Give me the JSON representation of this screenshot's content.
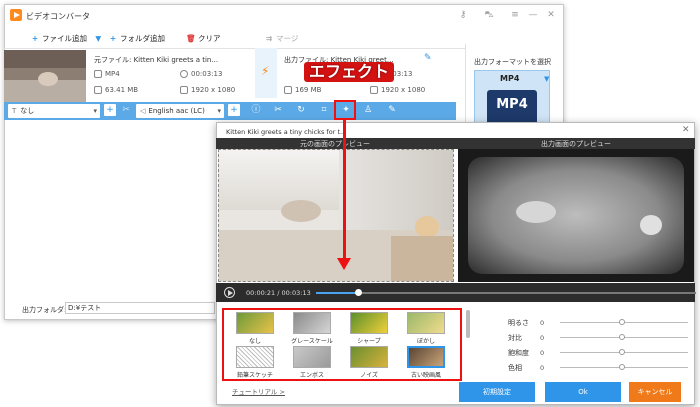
{
  "main_window": {
    "title": "ビデオコンバータ",
    "titlebar_icons": [
      "key-icon",
      "cart-icon",
      "menu-icon",
      "minimize-icon",
      "close-icon"
    ],
    "toolbar": {
      "add_file": "ファイル追加",
      "add_folder": "フォルダ追加",
      "clear": "クリア",
      "merge": "マージ"
    },
    "file": {
      "source_name": "元ファイル: Kitten Kiki greets a tin...",
      "source_format": "MP4",
      "source_duration": "00:03:13",
      "source_size": "63.41 MB",
      "source_resolution": "1920 x 1080",
      "output_name": "出力ファイル: Kitten Kiki greet...",
      "output_duration": "00:03:13",
      "output_size": "169 MB",
      "output_resolution": "1920 x 1080"
    },
    "effect_toolbar": {
      "subtitle_value": "なし",
      "audio_value": "English aac (LC)"
    },
    "side_panel": {
      "output_format_label": "出力フォーマットを選択",
      "format_name": "MP4",
      "format_image_text": "MP4"
    },
    "output_folder_label": "出力フォルダ:",
    "output_folder_value": "D:¥テスト"
  },
  "annotation": {
    "effect_label": "エフェクト"
  },
  "effect_dialog": {
    "title": "Kitten Kiki greets a tiny chicks for t...",
    "original_preview_label": "元の画面のプレビュー",
    "output_preview_label": "出力画面のプレビュー",
    "current_time": "00:00:21",
    "total_time": "00:03:13",
    "playback_progress": 0.11,
    "filters": [
      {
        "label": "なし"
      },
      {
        "label": "グレースケール"
      },
      {
        "label": "シャープ"
      },
      {
        "label": "ぼかし"
      },
      {
        "label": "鉛筆スケッチ"
      },
      {
        "label": "エンボス"
      },
      {
        "label": "ノイズ"
      },
      {
        "label": "古い映画風",
        "selected": true
      }
    ],
    "adjustments": [
      {
        "label": "明るさ",
        "value": "0"
      },
      {
        "label": "対比",
        "value": "0"
      },
      {
        "label": "飽和度",
        "value": "0"
      },
      {
        "label": "色相",
        "value": "0"
      }
    ],
    "tutorial_link": "チュートリアル >",
    "buttons": {
      "reset": "初期設定",
      "ok": "Ok",
      "cancel": "キャンセル"
    },
    "colors": {
      "blue_button": "#2f95e8",
      "cancel_button": "#f07a1a",
      "annotation_red": "#e11111"
    }
  }
}
